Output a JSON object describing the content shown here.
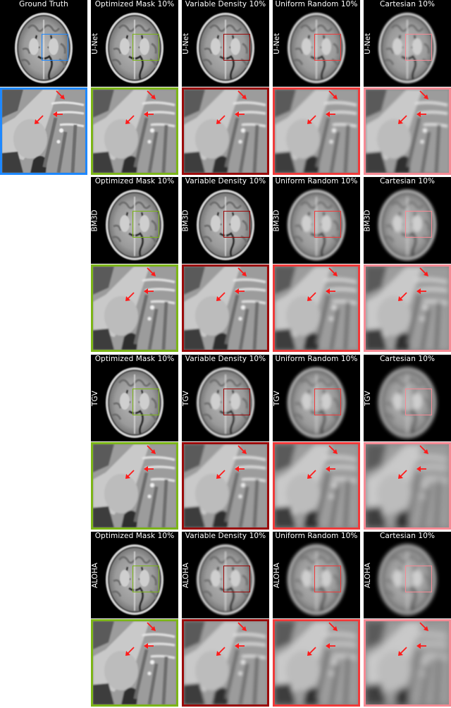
{
  "figure": {
    "ground_truth": {
      "title": "Ground Truth",
      "frame_color": "#1e88ff"
    },
    "sampling_masks": [
      {
        "label": "Optimized Mask 10%",
        "frame_color": "#7cb518"
      },
      {
        "label": "Variable Density 10%",
        "frame_color": "#9b0a0a"
      },
      {
        "label": "Uniform Random 10%",
        "frame_color": "#f03a3a"
      },
      {
        "label": "Cartesian 10%",
        "frame_color": "#f58a94"
      }
    ],
    "methods": [
      {
        "name": "U-Net",
        "blur": [
          0.6,
          0.9,
          1.1,
          1.2
        ]
      },
      {
        "name": "BM3D",
        "blur": [
          0.7,
          0.9,
          1.6,
          2.0
        ]
      },
      {
        "name": "TGV",
        "blur": [
          0.7,
          1.0,
          2.2,
          2.8
        ]
      },
      {
        "name": "ALOHA",
        "blur": [
          0.7,
          1.3,
          2.4,
          3.0
        ]
      }
    ],
    "annotation": {
      "arrow_color": "#ff1a1a",
      "arrow_count_per_zoom": 3
    }
  }
}
